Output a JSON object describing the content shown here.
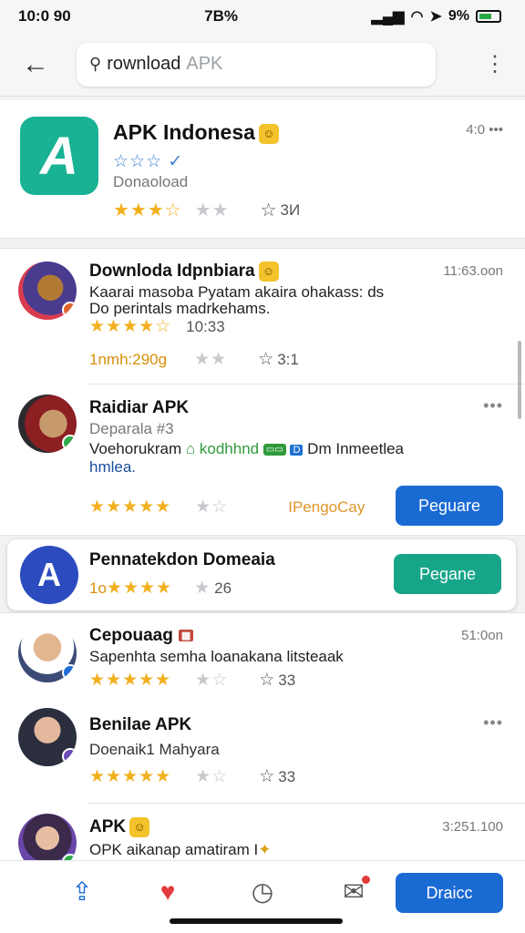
{
  "status_bar": {
    "time": "10:0 90",
    "center": "7B%",
    "battery": "9%"
  },
  "search": {
    "query": "rownload",
    "hint": "APK"
  },
  "featured": {
    "title": "APK Indonesa",
    "meta": "4:0 •••",
    "outline_stars": "☆☆☆",
    "subtitle": "Donaoload",
    "stars": "★★★",
    "stars_half": "☆",
    "stars_grey": "★★",
    "count": "3И"
  },
  "list": [
    {
      "title": "Downloda Idpnbiara",
      "time": "11:63.oon",
      "line1": "Kaarai masoba Pyatam akaira ohakass: ds",
      "line2": "Do perintals madrkehams.",
      "stars": "★★★★☆",
      "sub": "10:33",
      "gold_text": "1nmh:290g",
      "stars_grey": "★★",
      "count": "3:1"
    },
    {
      "title": "Raidiar APK",
      "sub": "Deparala #3",
      "line1_a": "Voehorukram",
      "line1_b": "kodhhnd",
      "line1_c": "Dm",
      "line1_d": "Inmeetlea",
      "line2": "hmlea.",
      "stars": "★★★★★",
      "stars_grey": "★☆",
      "gold_text": "IPengoCay",
      "button": "Peguare"
    }
  ],
  "promo": {
    "title": "Pennatekdon Domeaia",
    "gold_text": "1o",
    "stars": "★★★★",
    "count": "26",
    "button": "Pegane"
  },
  "list2": [
    {
      "title": "Cepouaag",
      "time": "51:0on",
      "line1": "Sapenhta semha loanakana litsteaak",
      "stars": "★★★★★",
      "stars_grey": "★☆",
      "count": "33"
    },
    {
      "title": "Benilae APK",
      "line1": "Doenaik1 Mahyara",
      "stars": "★★★★★",
      "stars_grey": "★☆",
      "count": "33"
    },
    {
      "title": "APK",
      "time": "3:251.100",
      "line1": "OPK aikanap amatiram I"
    }
  ],
  "bottom_nav": {
    "button": "Draicc"
  },
  "icons": [
    "back-arrow-icon",
    "search-icon",
    "more-vert-icon",
    "share-icon",
    "pin-icon",
    "clock-icon",
    "chat-icon"
  ],
  "colors": {
    "accent_blue": "#1a6ad3",
    "accent_green": "#17a589",
    "star_gold": "#f2b01e"
  }
}
